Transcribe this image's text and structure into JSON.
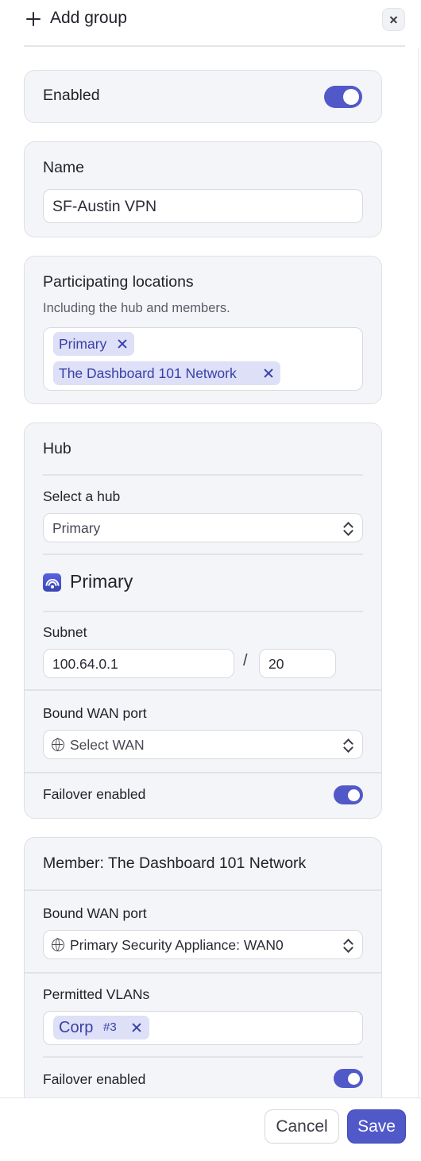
{
  "header": {
    "title": "Add group",
    "add_icon": "plus-icon",
    "close_icon": "close-icon"
  },
  "enabled": {
    "label": "Enabled",
    "on": true
  },
  "name": {
    "label": "Name",
    "value": "SF-Austin VPN"
  },
  "locations": {
    "label": "Participating locations",
    "help": "Including the hub and members.",
    "chips": [
      "Primary",
      "The Dashboard 101 Network"
    ]
  },
  "hub": {
    "title": "Hub",
    "select_label": "Select a hub",
    "selected": "Primary",
    "site_name": "Primary",
    "site_icon": "wifi-icon",
    "subnet_label": "Subnet",
    "subnet_ip": "100.64.0.1",
    "subnet_sep": "/",
    "subnet_mask": "20",
    "wan_label": "Bound WAN port",
    "wan_placeholder": "Select WAN",
    "failover_label": "Failover enabled",
    "failover_on": true
  },
  "member": {
    "title": "Member: The Dashboard 101 Network",
    "wan_label": "Bound WAN port",
    "wan_value": "Primary Security Appliance: WAN0",
    "vlans_label": "Permitted VLANs",
    "vlan_chip": {
      "name": "Corp",
      "badge": "#3"
    },
    "failover_label": "Failover enabled",
    "failover_on": true
  },
  "footer": {
    "cancel_label": "Cancel",
    "save_label": "Save"
  },
  "colors": {
    "accent": "#5159c9",
    "chip_bg": "#dde0f7",
    "card_bg": "#f4f5f8"
  }
}
